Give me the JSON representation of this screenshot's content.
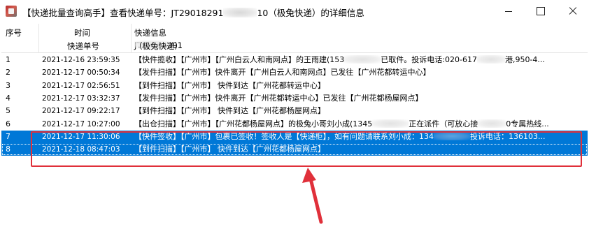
{
  "window": {
    "title_prefix": "【快递批量查询高手】查看快递单号：JT29018291",
    "title_suffix": "10（极兔快递）的详细信息"
  },
  "headers": {
    "no": "序号",
    "time": "时间",
    "tracking_no_label": "快递单号",
    "info": "快递信息",
    "info_sub": "JT29018291",
    "info_sub_suffix": "（极兔快递）"
  },
  "rows": [
    {
      "no": "1",
      "time": "2021-12-16 23:59:35",
      "pre": "【快件揽收】【广州市】【广州白云人和南网点】的王雨建(153",
      "post": "已取件。投诉电话:020-617",
      "post2": "港,950-4..."
    },
    {
      "no": "2",
      "time": "2021-12-17 00:50:34",
      "pre": "【发件扫描】【广州市】快件离开【广州白云人和南网点】已发往【广州花都转运中心】",
      "post": "",
      "post2": ""
    },
    {
      "no": "3",
      "time": "2021-12-17 02:56:51",
      "pre": "【到件扫描】【广州市】 快件到达【广州花都转运中心】",
      "post": "",
      "post2": ""
    },
    {
      "no": "4",
      "time": "2021-12-17 03:32:37",
      "pre": "【发件扫描】【广州市】快件离开【广州花都转运中心】已发往【广州花都杨屋网点】",
      "post": "",
      "post2": ""
    },
    {
      "no": "5",
      "time": "2021-12-17 09:22:17",
      "pre": "【到件扫描】【广州市】 快件到达【广州花都杨屋网点】",
      "post": "",
      "post2": ""
    },
    {
      "no": "6",
      "time": "2021-12-17 10:27:00",
      "pre": "【出仓扫描】【广州市】【广州花都杨屋网点】的极兔小哥刘小成(1345",
      "post": "正在派件（可放心接",
      "post2": "0专属热线..."
    },
    {
      "no": "7",
      "time": "2021-12-17 11:30:06",
      "pre": "【快件签收】【广州市】包裹已签收！签收人是【快递柜】，如有问题请联系刘小成：134",
      "post": "投诉电话：136103...",
      "post2": ""
    },
    {
      "no": "8",
      "time": "2021-12-18 08:47:03",
      "pre": "【到件扫描】【广州市】 快件到达【广州花都杨屋网点】",
      "post": "",
      "post2": ""
    }
  ],
  "colors": {
    "selection": "#0078d7",
    "annotation": "#e0303a"
  }
}
